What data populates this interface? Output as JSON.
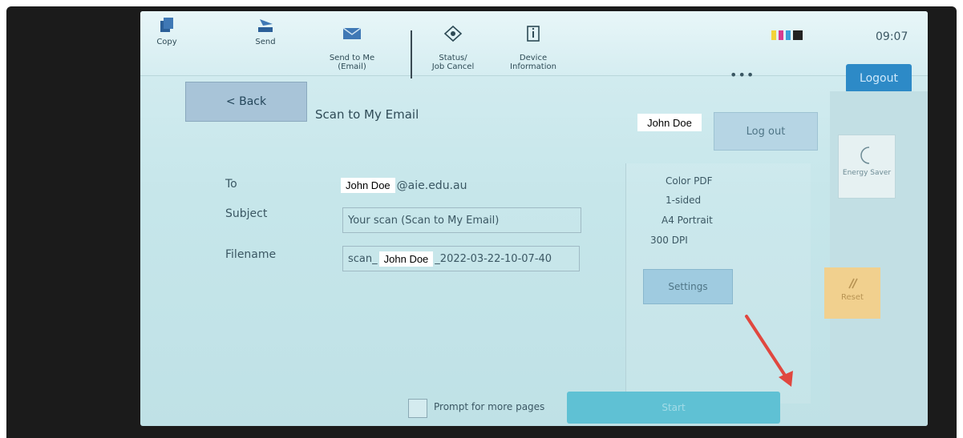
{
  "topbar": {
    "buttons": [
      {
        "label": "Copy",
        "icon": "copy-icon"
      },
      {
        "label": "Send",
        "icon": "send-icon"
      },
      {
        "label": "Send to Me\n(Email)",
        "icon": "email-icon"
      },
      {
        "label": "Status/\nJob Cancel",
        "icon": "eye-icon"
      },
      {
        "label": "Device\nInformation",
        "icon": "device-info-icon"
      }
    ],
    "time": "09:07",
    "more": "•••",
    "logout_label": "Logout"
  },
  "header": {
    "back_label": "< Back",
    "title": "Scan to My Email",
    "user": "John Doe",
    "logout_label": "Log out"
  },
  "form": {
    "to_label": "To",
    "to_user": "John Doe",
    "to_domain": "@aie.edu.au",
    "subject_label": "Subject",
    "subject_value": "Your scan (Scan to My Email)",
    "filename_label": "Filename",
    "filename_prefix": "scan_",
    "filename_user": "John Doe",
    "filename_suffix": "_2022-03-22-10-07-40"
  },
  "settings": {
    "lines": [
      "Color PDF",
      "1-sided",
      "A4 Portrait",
      "300 DPI"
    ],
    "button_label": "Settings"
  },
  "sidebar": {
    "energy_saver": "Energy Saver",
    "reset": "Reset"
  },
  "footer": {
    "prompt_label": "Prompt for more pages",
    "start_label": "Start"
  },
  "colors": {
    "accent": "#2d8ac7",
    "start": "#5fc1d4",
    "reset": "#f1d08e",
    "annotation_arrow": "#e0473f"
  }
}
